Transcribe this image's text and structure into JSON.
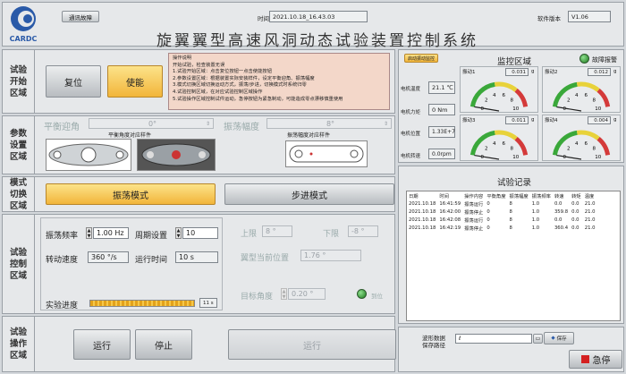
{
  "header": {
    "status_button": "通讯故障",
    "time_label": "时间",
    "time_value": "2021.10.18_16.43.03",
    "version_label": "软件版本",
    "version_value": "V1.06",
    "logo_text": "CARDC",
    "title": "旋翼翼型高速风洞动态试验装置控制系统"
  },
  "start_section": {
    "label": "试验开始区域",
    "reset": "复位",
    "enable": "使能",
    "instructions": [
      "操作说明",
      "开始试验，检查装置无误",
      "1.试验开始区域：点击复位按钮一点击使能按钮",
      "2.参数设置区域：根据装置实际安装样件，设定平衡迎角、振荡幅度",
      "3.模式切换区域切换运动方式，振荡/步进，切换模式时系统归零",
      "4.试验控制区域，在对应试验控制区域操作",
      "5.试验操作区域控制试件运动，急停按钮为紧急制动，可能造成零点漂移慎重使用"
    ]
  },
  "params_section": {
    "label": "参数设置区域",
    "balance_angle_label": "平衡迎角",
    "balance_angle_value": "0°",
    "balance_sample_label": "平衡角度对应样件",
    "amplitude_label": "振荡幅度",
    "amplitude_value": "8°",
    "amplitude_sample_label": "振荡幅度对应样件"
  },
  "mode_section": {
    "label": "模式切换区域",
    "oscillate": "振荡模式",
    "step": "步进模式"
  },
  "control_section": {
    "label": "试验控制区域",
    "freq_label": "振荡频率",
    "freq_value": "1.00 Hz",
    "period_label": "周期设置",
    "period_value": "10",
    "speed_label": "转动速度",
    "speed_value": "360 °/s",
    "runtime_label": "运行时间",
    "runtime_value": "10 s",
    "progress_label": "实验进度",
    "progress_value": "11 s",
    "progress_fraction": 1.0,
    "upper_label": "上限",
    "upper_value": "8 °",
    "lower_label": "下限",
    "lower_value": "-8 °",
    "current_pos_label": "翼型当前位置",
    "current_pos_value": "1.76 °",
    "target_label": "目标角度",
    "target_value": "0.20 °",
    "in_place_label": "到位"
  },
  "operate_section": {
    "label": "试验操作区域",
    "run": "运行",
    "stop": "停止",
    "run2": "运行"
  },
  "monitor": {
    "start_button": "启动振动监控",
    "title": "监控区域",
    "alarm_label": "故障报警",
    "temp_label": "电机温度",
    "temp_value": "21.1 ℃",
    "torque_label": "电机力矩",
    "torque_value": "0 Nm",
    "position_label": "电机位置",
    "position_value": "1.33E+7",
    "rpm_label": "电机转速",
    "rpm_value": "0.0rpm",
    "gauges": [
      {
        "name": "振动1",
        "value": "0.031",
        "unit": "g",
        "ticks": [
          "0",
          "2",
          "4",
          "6",
          "8",
          "10"
        ],
        "reading": 0.031
      },
      {
        "name": "振动2",
        "value": "0.012",
        "unit": "g",
        "ticks": [
          "0",
          "2",
          "4",
          "6",
          "8",
          "10"
        ],
        "reading": 0.012
      },
      {
        "name": "振动3",
        "value": "0.011",
        "unit": "g",
        "ticks": [
          "0",
          "2",
          "4",
          "6",
          "8",
          "10"
        ],
        "reading": 0.011
      },
      {
        "name": "振动4",
        "value": "0.004",
        "unit": "g",
        "ticks": [
          "0",
          "2",
          "4",
          "6",
          "8",
          "10"
        ],
        "reading": 0.004
      }
    ]
  },
  "log": {
    "title": "试验记录",
    "headers": [
      "日期",
      "时间",
      "操作内容",
      "平衡角度",
      "振荡幅度",
      "振荡频率",
      "转速",
      "转矩",
      "温度"
    ],
    "rows": [
      [
        "2021.10.18",
        "16:41:59",
        "振荡运行",
        "0",
        "8",
        "1.0",
        "0.0",
        "0.0",
        "21.0"
      ],
      [
        "2021.10.18",
        "16:42:00",
        "振荡停止",
        "0",
        "8",
        "1.0",
        "359.8",
        "0.0",
        "21.0"
      ],
      [
        "2021.10.18",
        "16:42:08",
        "振荡运行",
        "0",
        "8",
        "1.0",
        "0.0",
        "0.0",
        "21.0"
      ],
      [
        "2021.10.18",
        "16:42:19",
        "振荡停止",
        "0",
        "8",
        "1.0",
        "360.4",
        "0.0",
        "21.0"
      ]
    ]
  },
  "save": {
    "label_line1": "波形数据",
    "label_line2": "保存路径",
    "button": "保存",
    "estop": "急停"
  },
  "colors": {
    "enable_yellow": "#f2b53a",
    "estop_red": "#d42020",
    "alarm_green": "#1c7a1c",
    "progress_orange": "#e3a21a"
  }
}
